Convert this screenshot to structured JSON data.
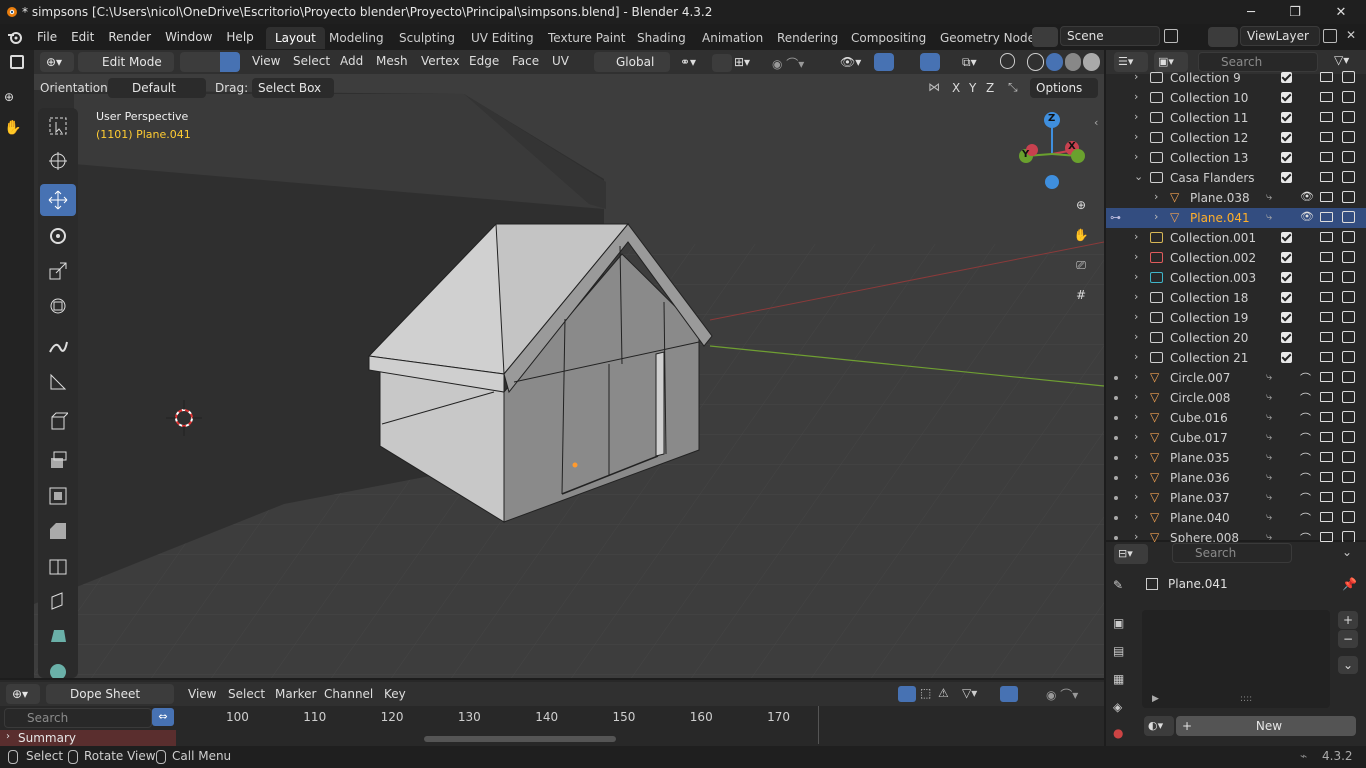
{
  "window": {
    "title": "* simpsons [C:\\Users\\nicol\\OneDrive\\Escritorio\\Proyecto blender\\Proyecto\\Principal\\simpsons.blend] - Blender 4.3.2"
  },
  "menu": [
    "File",
    "Edit",
    "Render",
    "Window",
    "Help"
  ],
  "workspaces": [
    "Layout",
    "Modeling",
    "Sculpting",
    "UV Editing",
    "Texture Paint",
    "Shading",
    "Animation",
    "Rendering",
    "Compositing",
    "Geometry Node"
  ],
  "active_workspace": "Layout",
  "scene": "Scene",
  "view_layer": "ViewLayer",
  "viewport_header": {
    "mode": "Edit Mode",
    "menus": [
      "View",
      "Select",
      "Add",
      "Mesh",
      "Vertex",
      "Edge",
      "Face",
      "UV"
    ],
    "transform_orientation": "Global",
    "orientation_label": "Orientation:",
    "orientation_value": "Default",
    "drag_label": "Drag:",
    "drag_value": "Select Box",
    "axes": [
      "X",
      "Y",
      "Z"
    ],
    "options": "Options"
  },
  "viewport": {
    "perspective": "User Perspective",
    "object_info": "(1101) Plane.041",
    "gizmo": {
      "x": "X",
      "y": "Y",
      "z": "Z"
    }
  },
  "outliner": {
    "search_placeholder": "Search",
    "rows": [
      {
        "name": "Collection 9",
        "type": "collection",
        "indent": 1
      },
      {
        "name": "Collection 10",
        "type": "collection",
        "indent": 1
      },
      {
        "name": "Collection 11",
        "type": "collection",
        "indent": 1
      },
      {
        "name": "Collection 12",
        "type": "collection",
        "indent": 1
      },
      {
        "name": "Collection 13",
        "type": "collection",
        "indent": 1
      },
      {
        "name": "Casa Flanders",
        "type": "collection",
        "indent": 1,
        "expanded": true
      },
      {
        "name": "Plane.038",
        "type": "mesh",
        "indent": 2
      },
      {
        "name": "Plane.041",
        "type": "mesh",
        "indent": 2,
        "selected": true
      },
      {
        "name": "Collection.001",
        "type": "collection",
        "indent": 1,
        "color": "#d6b656"
      },
      {
        "name": "Collection.002",
        "type": "collection",
        "indent": 1,
        "color": "#e05b5b"
      },
      {
        "name": "Collection.003",
        "type": "collection",
        "indent": 1,
        "color": "#3fb5c9"
      },
      {
        "name": "Collection 18",
        "type": "collection",
        "indent": 1
      },
      {
        "name": "Collection 19",
        "type": "collection",
        "indent": 1
      },
      {
        "name": "Collection 20",
        "type": "collection",
        "indent": 1
      },
      {
        "name": "Collection 21",
        "type": "collection",
        "indent": 1
      },
      {
        "name": "Circle.007",
        "type": "mesh",
        "indent": 1,
        "dot": true
      },
      {
        "name": "Circle.008",
        "type": "mesh",
        "indent": 1,
        "dot": true
      },
      {
        "name": "Cube.016",
        "type": "mesh",
        "indent": 1,
        "dot": true
      },
      {
        "name": "Cube.017",
        "type": "mesh",
        "indent": 1,
        "dot": true
      },
      {
        "name": "Plane.035",
        "type": "mesh",
        "indent": 1,
        "dot": true
      },
      {
        "name": "Plane.036",
        "type": "mesh",
        "indent": 1,
        "dot": true
      },
      {
        "name": "Plane.037",
        "type": "mesh",
        "indent": 1,
        "dot": true
      },
      {
        "name": "Plane.040",
        "type": "mesh",
        "indent": 1,
        "dot": true
      },
      {
        "name": "Sphere.008",
        "type": "mesh",
        "indent": 1,
        "dot": true
      }
    ]
  },
  "properties": {
    "search_placeholder": "Search",
    "object": "Plane.041",
    "new_button": "New"
  },
  "timeline": {
    "editor": "Dope Sheet",
    "menus": [
      "View",
      "Select",
      "Marker",
      "Channel",
      "Key"
    ],
    "search_placeholder": "Search",
    "summary": "Summary",
    "frames": [
      "100",
      "110",
      "120",
      "130",
      "140",
      "150",
      "160",
      "170"
    ]
  },
  "status": {
    "items": [
      "Select",
      "Rotate View",
      "Call Menu"
    ],
    "version": "4.3.2"
  },
  "colors": {
    "accent": "#4772b3",
    "selected_text": "#ffaf29",
    "object_info": "#ffcc33"
  }
}
